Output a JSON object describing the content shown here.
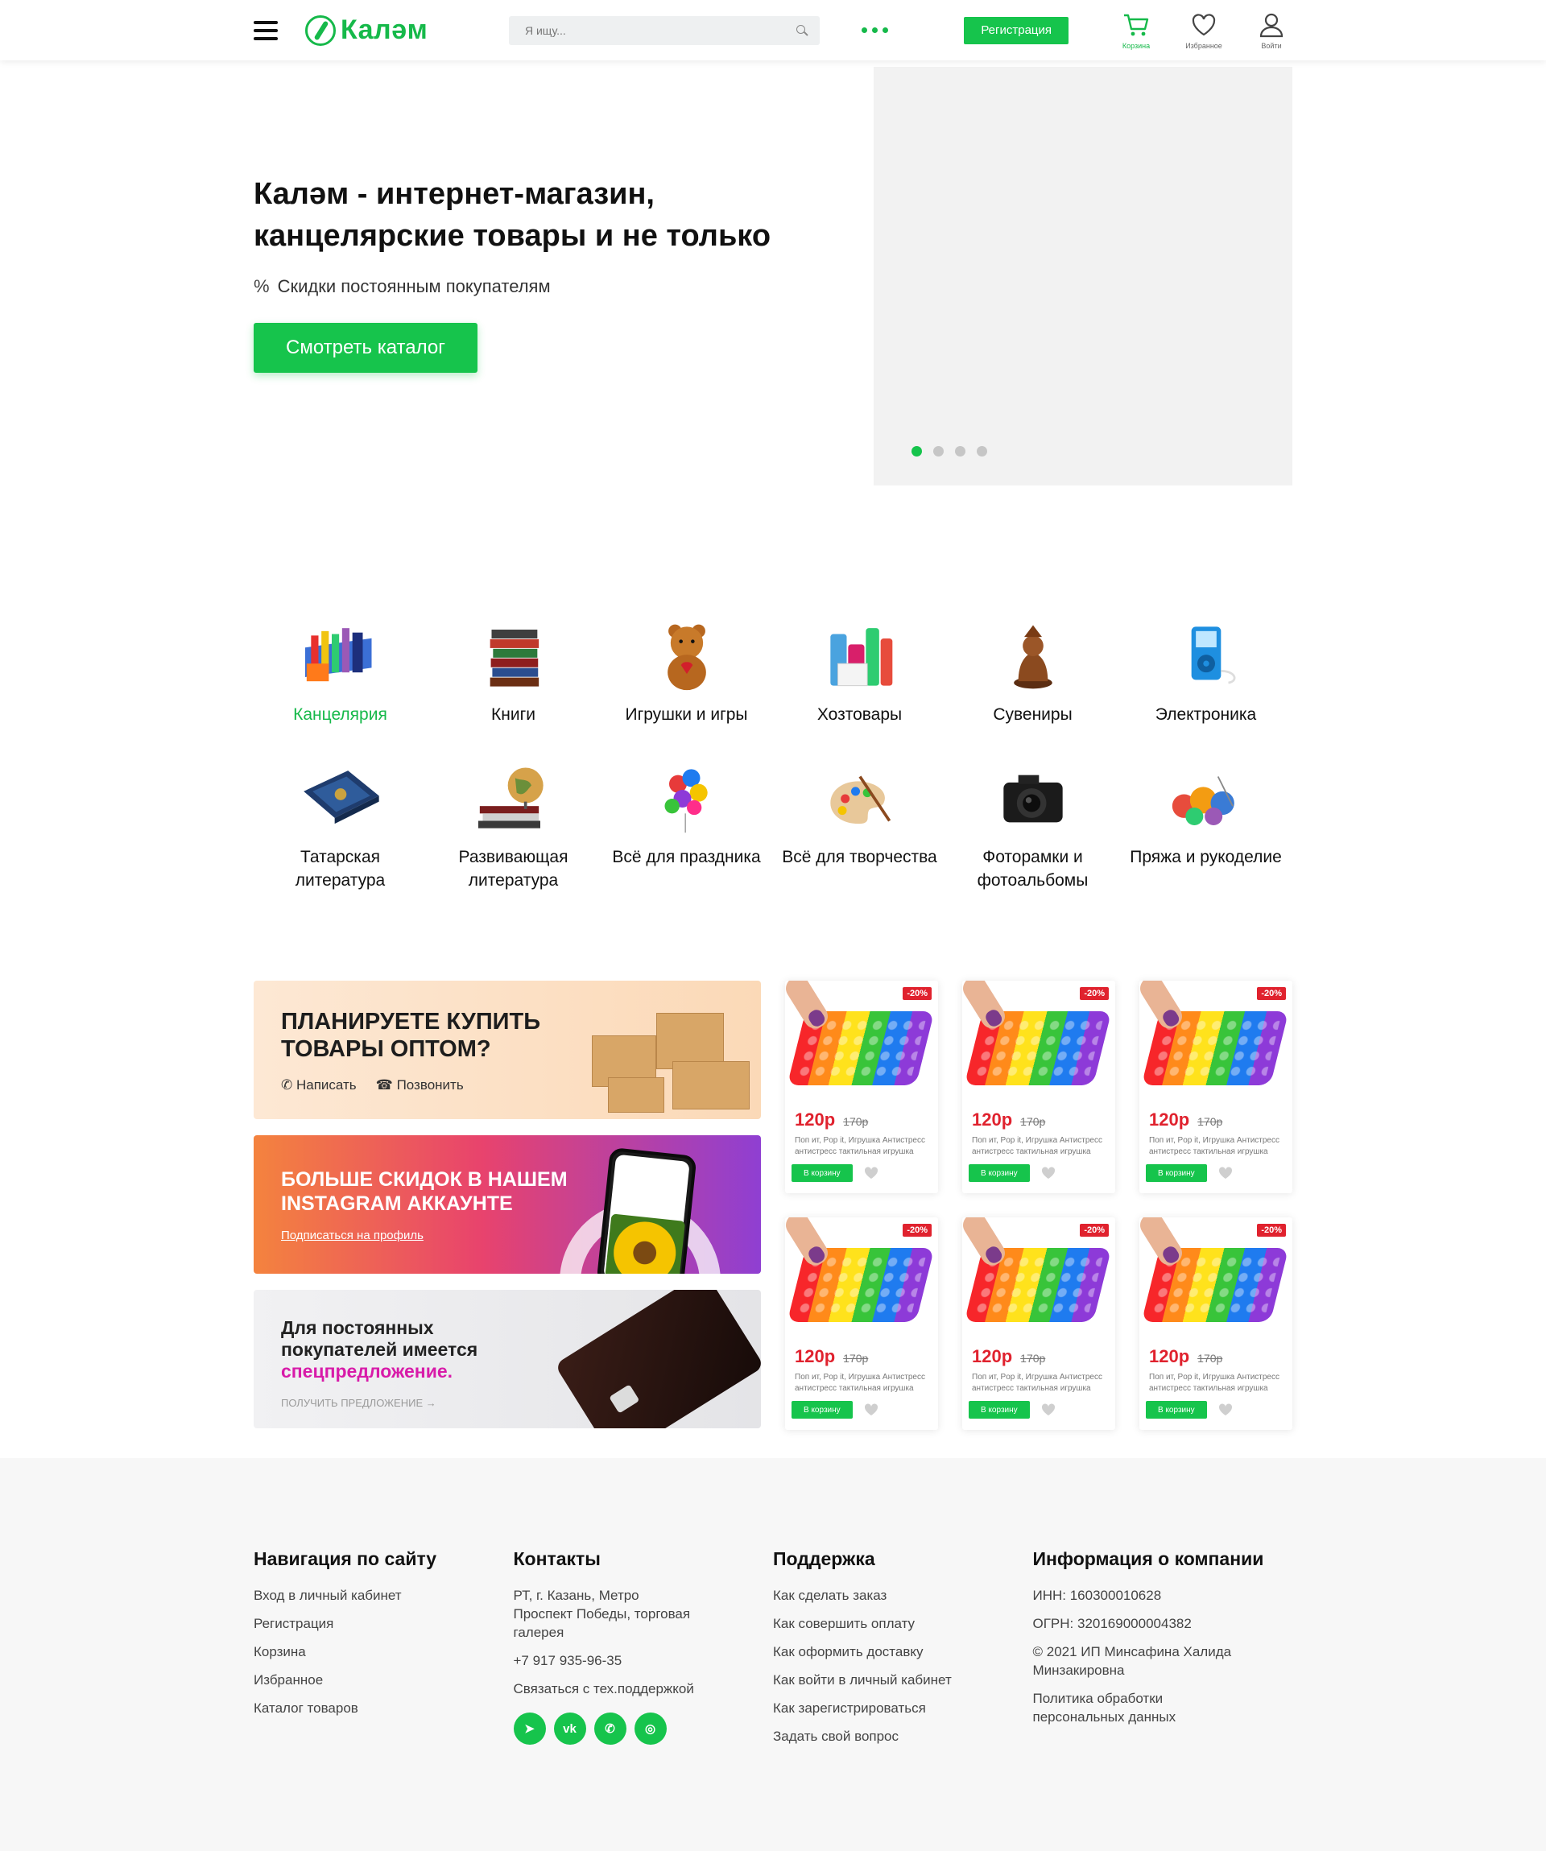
{
  "header": {
    "logo_text": "Каләм",
    "search_placeholder": "Я ищу...",
    "register_label": "Регистрация",
    "icons": [
      {
        "name": "cart-icon",
        "label": "Корзина"
      },
      {
        "name": "heart-icon",
        "label": "Избранное"
      },
      {
        "name": "user-icon",
        "label": "Войти"
      }
    ],
    "accent": "#16c44c"
  },
  "hero": {
    "title_line1": "Каләм - интернет-магазин,",
    "title_line2": "канцелярские товары и не только",
    "subtitle": "Скидки постоянным покупателям",
    "cta": "Смотреть каталог",
    "slide_count": 4,
    "active_slide": 1
  },
  "categories": [
    {
      "label": "Канцелярия",
      "icon": "stationery-icon"
    },
    {
      "label": "Книги",
      "icon": "books-icon"
    },
    {
      "label": "Игрушки и игры",
      "icon": "teddy-bear-icon"
    },
    {
      "label": "Хозтовары",
      "icon": "household-icon"
    },
    {
      "label": "Сувениры",
      "icon": "souvenir-icon"
    },
    {
      "label": "Электроника",
      "icon": "mp3-player-icon"
    },
    {
      "label": "Татарская литература",
      "icon": "tatar-book-icon"
    },
    {
      "label": "Развивающая литература",
      "icon": "globe-books-icon"
    },
    {
      "label": "Всё для праздника",
      "icon": "balloons-icon"
    },
    {
      "label": "Всё для творчества",
      "icon": "palette-icon"
    },
    {
      "label": "Фоторамки и фотоальбомы",
      "icon": "camera-icon"
    },
    {
      "label": "Пряжа и рукоделие",
      "icon": "yarn-icon"
    }
  ],
  "banners": {
    "wholesale": {
      "title": "ПЛАНИРУЕТЕ КУПИТЬ ТОВАРЫ ОПТОМ?",
      "write": "Написать",
      "call": "Позвонить"
    },
    "instagram": {
      "title": "БОЛЬШЕ СКИДОК В НАШЕМ INSTAGRAM АККАУНТЕ",
      "link": "Подписаться на профиль"
    },
    "loyal": {
      "title_a": "Для постоянных покупателей имеется",
      "title_b": "спецпредложение.",
      "link": "ПОЛУЧИТЬ ПРЕДЛОЖЕНИЕ →"
    }
  },
  "products": [
    {
      "discount": "-20%",
      "price": "120р",
      "old_price": "170р",
      "desc1": "Поп ит, Pop it, Игрушка Антистресс",
      "desc2": "антистресс тактильная игрушка",
      "cart": "В корзину"
    },
    {
      "discount": "-20%",
      "price": "120р",
      "old_price": "170р",
      "desc1": "Поп ит, Pop it, Игрушка Антистресс",
      "desc2": "антистресс тактильная игрушка",
      "cart": "В корзину"
    },
    {
      "discount": "-20%",
      "price": "120р",
      "old_price": "170р",
      "desc1": "Поп ит, Pop it, Игрушка Антистресс",
      "desc2": "антистресс тактильная игрушка",
      "cart": "В корзину"
    },
    {
      "discount": "-20%",
      "price": "120р",
      "old_price": "170р",
      "desc1": "Поп ит, Pop it, Игрушка Антистресс",
      "desc2": "антистресс тактильная игрушка",
      "cart": "В корзину"
    },
    {
      "discount": "-20%",
      "price": "120р",
      "old_price": "170р",
      "desc1": "Поп ит, Pop it, Игрушка Антистресс",
      "desc2": "антистресс тактильная игрушка",
      "cart": "В корзину"
    },
    {
      "discount": "-20%",
      "price": "120р",
      "old_price": "170р",
      "desc1": "Поп ит, Pop it, Игрушка Антистресс",
      "desc2": "антистресс тактильная игрушка",
      "cart": "В корзину"
    }
  ],
  "footer": {
    "nav": {
      "title": "Навигация по сайту",
      "items": [
        "Вход в личный кабинет",
        "Регистрация",
        "Корзина",
        "Избранное",
        "Каталог товаров"
      ]
    },
    "contacts": {
      "title": "Контакты",
      "address": "РТ, г. Казань, Метро Проспект Победы, торговая галерея",
      "phone": "+7 917 935-96-35",
      "support": "Связаться с тех.поддержкой",
      "socials": [
        "telegram-icon",
        "vk-icon",
        "whatsapp-icon",
        "instagram-icon"
      ]
    },
    "support": {
      "title": "Поддержка",
      "items": [
        "Как сделать заказ",
        "Как совершить оплату",
        "Как оформить доставку",
        "Как войти в личный кабинет",
        "Как зарегистрироваться",
        "Задать свой вопрос"
      ]
    },
    "company": {
      "title": "Информация о компании",
      "inn": "ИНН: 160300010628",
      "ogrn": "ОГРН: 320169000004382",
      "copyright": "© 2021 ИП Минсафина Халида Минзакировна",
      "policy": "Политика обработки персональных данных"
    }
  }
}
